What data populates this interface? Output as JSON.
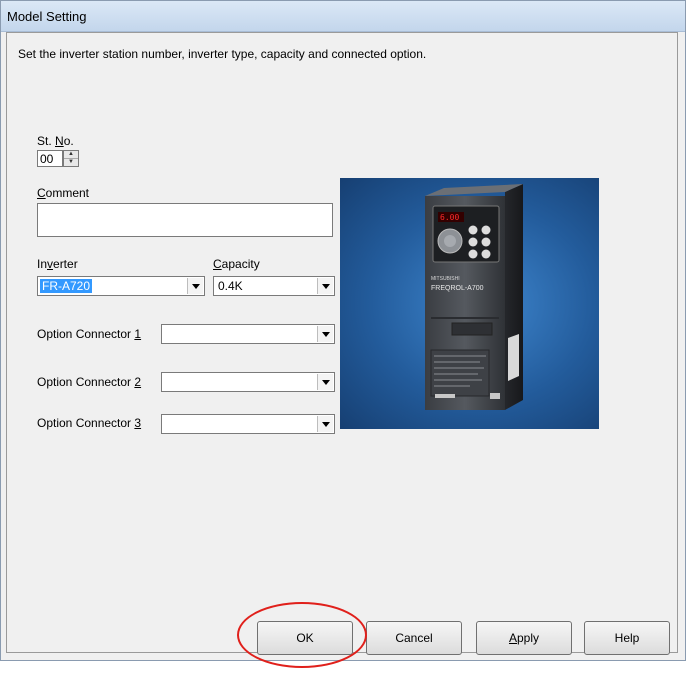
{
  "window": {
    "title": "Model Setting",
    "description": "Set the inverter station number, inverter type, capacity and connected option."
  },
  "station": {
    "label_pre": "St. ",
    "label_mnemonic": "N",
    "label_post": "o.",
    "value": "00"
  },
  "comment": {
    "label_pre": "",
    "label_mnemonic": "C",
    "label_post": "omment",
    "value": ""
  },
  "inverter": {
    "label_pre": "In",
    "label_mnemonic": "v",
    "label_post": "erter",
    "value": "FR-A720"
  },
  "capacity": {
    "label_pre": "",
    "label_mnemonic": "C",
    "label_post": "apacity",
    "value": "0.4K"
  },
  "options": [
    {
      "label_pre": "Option Connector ",
      "label_mnemonic": "1",
      "value": ""
    },
    {
      "label_pre": "Option Connector ",
      "label_mnemonic": "2",
      "value": ""
    },
    {
      "label_pre": "Option Connector ",
      "label_mnemonic": "3",
      "value": ""
    }
  ],
  "product_image": {
    "brand_text": "MITSUBISHI",
    "series_text": "FREQROL-A700",
    "display_text": "6.00"
  },
  "buttons": {
    "ok": "OK",
    "cancel": "Cancel",
    "apply_mnemonic": "A",
    "apply_rest": "pply",
    "help": "Help"
  },
  "colors": {
    "selection": "#3399ff",
    "highlight_ring": "#e0201b",
    "image_background": "#235c9c"
  }
}
